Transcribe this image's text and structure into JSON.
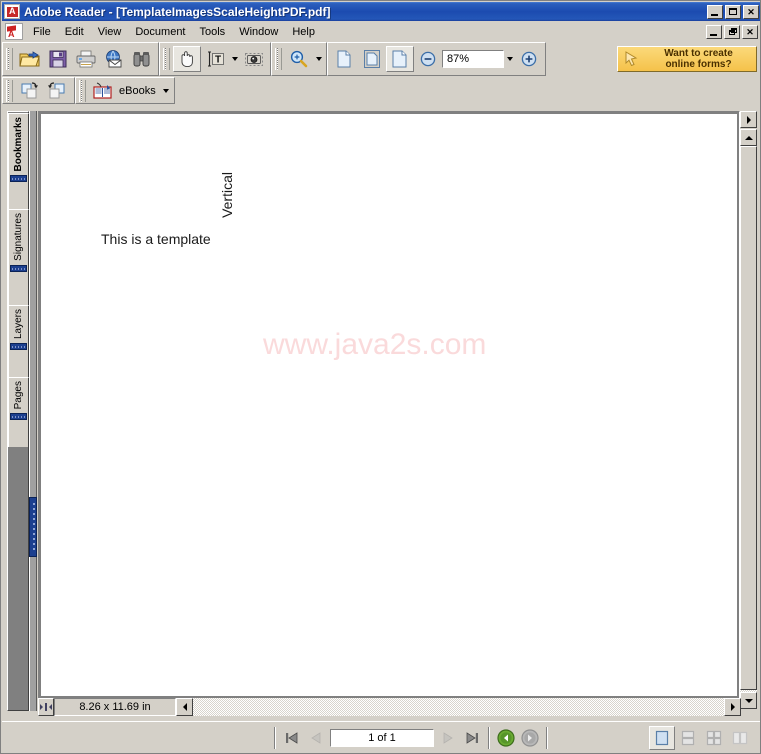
{
  "window": {
    "title": "Adobe Reader - [TemplateImagesScaleHeightPDF.pdf]",
    "app_icon": "adobe-reader-icon",
    "controls": {
      "minimize": "_",
      "maximize": "□",
      "restore": "❐",
      "close": "✕"
    }
  },
  "menu": {
    "items": [
      {
        "label": "File"
      },
      {
        "label": "Edit"
      },
      {
        "label": "View"
      },
      {
        "label": "Document"
      },
      {
        "label": "Tools"
      },
      {
        "label": "Window"
      },
      {
        "label": "Help"
      }
    ]
  },
  "toolbar1": {
    "file_group": [
      {
        "name": "open-file-button",
        "icon": "open-folder-icon",
        "tooltip": "Open"
      },
      {
        "name": "save-button",
        "icon": "floppy-disk-icon",
        "tooltip": "Save a Copy"
      },
      {
        "name": "print-button",
        "icon": "printer-icon",
        "tooltip": "Print"
      },
      {
        "name": "email-button",
        "icon": "email-globe-icon",
        "tooltip": "Email"
      },
      {
        "name": "search-button",
        "icon": "binoculars-icon",
        "tooltip": "Search"
      }
    ],
    "tools_group": [
      {
        "name": "hand-tool-button",
        "icon": "hand-icon",
        "selected": true
      },
      {
        "name": "select-text-button",
        "icon": "text-select-icon",
        "has_dropdown": true
      },
      {
        "name": "snapshot-button",
        "icon": "camera-icon"
      }
    ],
    "zoom_group": [
      {
        "name": "zoom-tool-button",
        "icon": "magnifier-icon",
        "has_dropdown": true
      }
    ],
    "view_group": [
      {
        "name": "actual-size-button",
        "icon": "page-actual-icon"
      },
      {
        "name": "fit-page-button",
        "icon": "page-fit-icon"
      },
      {
        "name": "fit-width-button",
        "icon": "page-width-icon",
        "selected": true
      }
    ],
    "zoom_out_icon": "zoom-out-icon",
    "zoom_in_icon": "zoom-in-icon",
    "zoom_value": "87%",
    "zoom_dropdown_icon": "chevron-down-icon"
  },
  "forms_banner": {
    "line1": "Want to create",
    "line2": "online forms?",
    "icon": "arrow-cursor-icon",
    "bg": "#f5c24a"
  },
  "toolbar2": {
    "rotate_group": [
      {
        "name": "rotate-clockwise-button",
        "icon": "rotate-cw-icon"
      },
      {
        "name": "rotate-counterclockwise-button",
        "icon": "rotate-ccw-icon"
      }
    ],
    "ebooks": {
      "label": "eBooks",
      "icon": "ebooks-icon",
      "dropdown_icon": "chevron-down-icon"
    }
  },
  "navpane": {
    "tabs": [
      {
        "label": "Bookmarks",
        "active": true
      },
      {
        "label": "Signatures",
        "active": false
      },
      {
        "label": "Layers",
        "active": false
      },
      {
        "label": "Pages",
        "active": false
      }
    ],
    "expand_icon": "expand-right-icon"
  },
  "document": {
    "page_background": "#ffffff",
    "texts": [
      {
        "name": "template-horizontal-text",
        "value": "This is a template",
        "orientation": "horizontal"
      },
      {
        "name": "template-vertical-text",
        "value": "Vertical",
        "orientation": "vertical"
      }
    ],
    "watermark": {
      "text": "www.java2s.com",
      "color": "#fadadb"
    },
    "page_size_label": "8.26 x 11.69 in"
  },
  "statusbar": {
    "first_page_icon": "first-page-icon",
    "prev_page_icon": "previous-page-icon",
    "page_indicator": "1 of 1",
    "next_page_icon": "next-page-icon",
    "last_page_icon": "last-page-icon",
    "back_icon": "go-back-icon",
    "forward_icon": "go-forward-icon",
    "back_color": "#5a9e2f",
    "forward_color": "#a8a8a8",
    "layout_buttons": [
      {
        "name": "single-page-layout-button",
        "icon": "single-page-icon",
        "selected": true
      },
      {
        "name": "continuous-layout-button",
        "icon": "continuous-page-icon",
        "selected": false
      },
      {
        "name": "facing-layout-button",
        "icon": "facing-pages-icon",
        "selected": false
      },
      {
        "name": "continuous-facing-layout-button",
        "icon": "continuous-facing-icon",
        "selected": false
      }
    ]
  }
}
